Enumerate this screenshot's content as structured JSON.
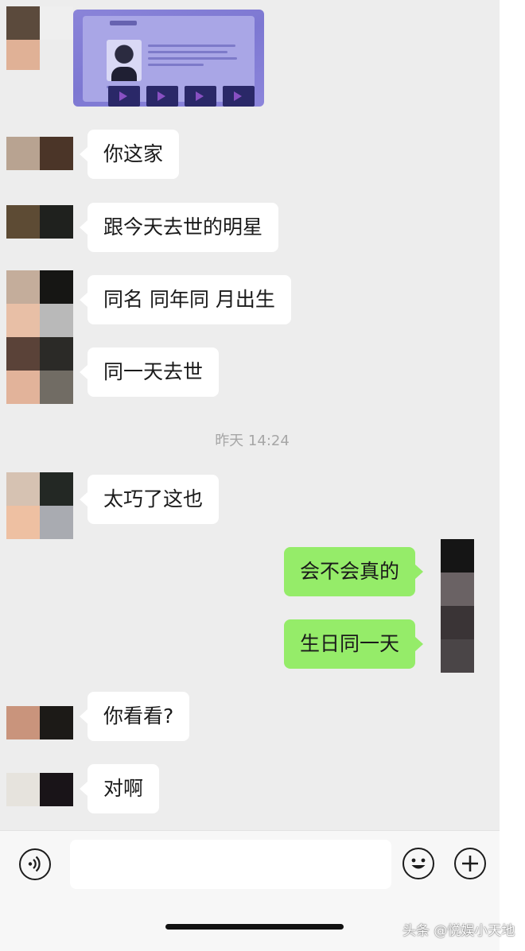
{
  "chat": {
    "timestamp": "昨天 14:24",
    "messages": [
      {
        "side": "left",
        "text": "你这家"
      },
      {
        "side": "left",
        "text": "跟今天去世的明星"
      },
      {
        "side": "left",
        "text": "同名 同年同 月出生"
      },
      {
        "side": "left",
        "text": "同一天去世"
      },
      {
        "side": "left",
        "text": "太巧了这也"
      },
      {
        "side": "right",
        "text": "会不会真的"
      },
      {
        "side": "right",
        "text": "生日同一天"
      },
      {
        "side": "left",
        "text": "你看看?"
      },
      {
        "side": "left",
        "text": "对啊"
      }
    ]
  },
  "input_bar": {
    "voice_icon": "voice-wave-icon",
    "emoji_icon": "smile-face-icon",
    "plus_icon": "plus-circle-icon"
  },
  "watermark": "头条 @悦娱小天地",
  "colors": {
    "chat_background": "#ededed",
    "left_bubble": "#ffffff",
    "right_bubble": "#95ec69",
    "timestamp_text": "#a6a6a6"
  }
}
